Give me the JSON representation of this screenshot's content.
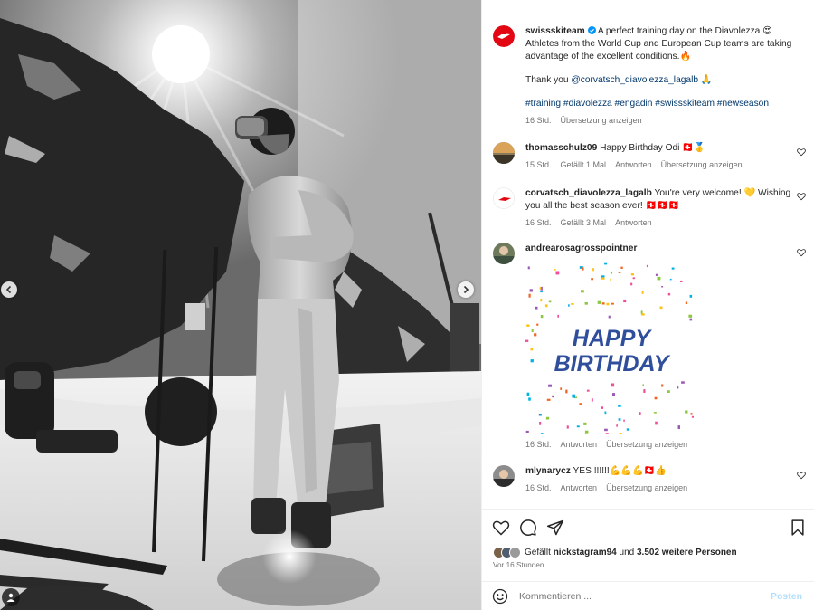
{
  "post": {
    "username": "swissskiteam",
    "caption_line1": "A perfect training day on the Diavolezza 😍",
    "caption_line2": "Athletes from the World Cup and European Cup teams are taking",
    "caption_line3": "advantage of the excellent conditions.🔥",
    "thanks_prefix": "Thank you ",
    "thanks_mention": "@corvatsch_diavolezza_lagalb",
    "thanks_suffix": " 🙏",
    "hashtags": "#training #diavolezza #engadin #swissskiteam #newseason",
    "time": "16 Std.",
    "translate": "Übersetzung anzeigen"
  },
  "comments": [
    {
      "username": "thomasschulz09",
      "text": "Happy Birthday Odi 🇨🇭🥇",
      "time": "15 Std.",
      "likes": "Gefällt 1 Mal",
      "reply": "Antworten",
      "translate": "Übersetzung anzeigen"
    },
    {
      "username": "corvatsch_diavolezza_lagalb",
      "text": "You're very welcome! 💛 Wishing",
      "text2": "you all the best season ever! 🇨🇭🇨🇭🇨🇭",
      "time": "16 Std.",
      "likes": "Gefällt 3 Mal",
      "reply": "Antworten"
    },
    {
      "username": "andrearosagrosspointner",
      "gif_line1": "HAPPY",
      "gif_line2": "BIRTHDAY",
      "time": "16 Std.",
      "reply": "Antworten",
      "translate": "Übersetzung anzeigen"
    },
    {
      "username": "mlynarycz",
      "text": "YES !!!!!!💪💪💪🇨🇭👍",
      "time": "16 Std.",
      "reply": "Antworten",
      "translate": "Übersetzung anzeigen"
    }
  ],
  "footer": {
    "likes_prefix": "Gefällt ",
    "likes_user": "nickstagram94",
    "likes_middle": " und ",
    "likes_count": "3.502 weitere Personen",
    "time_ago": "Vor 16 Stunden",
    "comment_placeholder": "Kommentieren ...",
    "post_label": "Posten"
  },
  "colors": {
    "brand_red": "#e30613",
    "link_blue": "#00376b",
    "hashtag_blue": "#00376b",
    "post_disabled": "#b2dffc"
  },
  "icons": [
    "chevron-left-icon",
    "chevron-right-icon",
    "user-tag-icon",
    "verified-icon",
    "heart-icon",
    "comment-icon",
    "share-icon",
    "bookmark-icon",
    "emoji-icon"
  ]
}
